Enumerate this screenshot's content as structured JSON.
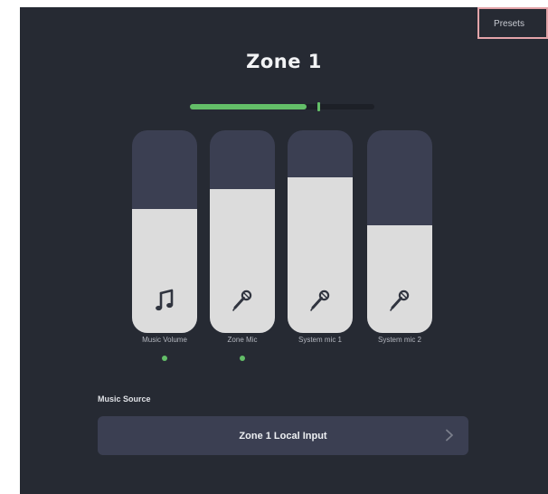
{
  "header": {
    "presets_label": "Presets",
    "zone_title": "Zone 1"
  },
  "level_meter": {
    "level": 0.63,
    "peak": 0.69,
    "fill_color": "#63be68"
  },
  "faders": [
    {
      "label": "Music Volume",
      "icon": "music-note-icon",
      "level": 0.61,
      "active": true
    },
    {
      "label": "Zone Mic",
      "icon": "microphone-icon",
      "level": 0.71,
      "active": true
    },
    {
      "label": "System mic 1",
      "icon": "microphone-icon",
      "level": 0.77,
      "active": false
    },
    {
      "label": "System mic 2",
      "icon": "microphone-icon",
      "level": 0.53,
      "active": false
    }
  ],
  "music_source": {
    "label": "Music Source",
    "value": "Zone 1 Local Input",
    "chevron_icon": "chevron-right-icon"
  },
  "colors": {
    "background": "#262a33",
    "fader_track": "#3b3f52",
    "fader_fill": "#dcdcdc",
    "active_indicator": "#63be68",
    "presets_border": "#e3a4a9"
  }
}
